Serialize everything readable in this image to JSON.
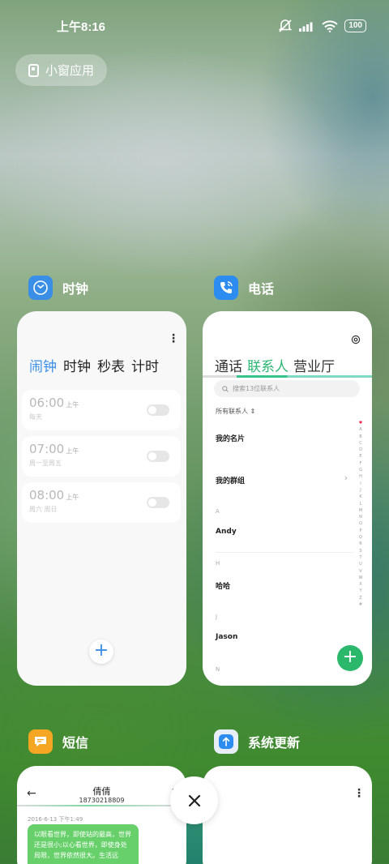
{
  "status_bar": {
    "time": "上午8:16",
    "battery": "100"
  },
  "small_window": {
    "label": "小窗应用"
  },
  "apps": {
    "clock": {
      "name": "时钟",
      "tabs": [
        "闹钟",
        "时钟",
        "秒表",
        "计时"
      ],
      "alarms": [
        {
          "time": "06:00",
          "ampm": "上午",
          "repeat": "每天"
        },
        {
          "time": "07:00",
          "ampm": "上午",
          "repeat": "周一至周五"
        },
        {
          "time": "08:00",
          "ampm": "上午",
          "repeat": "周六 周日"
        }
      ],
      "add": "+"
    },
    "phone": {
      "name": "电话",
      "tabs": [
        "通话",
        "联系人",
        "营业厅"
      ],
      "search_placeholder": "搜索13位联系人",
      "filter": "所有联系人",
      "my_card": "我的名片",
      "my_groups": "我的群组",
      "sections": [
        {
          "letter": "A",
          "name": "Andy"
        },
        {
          "letter": "H",
          "name": "哈哈"
        },
        {
          "letter": "J",
          "name": "Jason"
        },
        {
          "letter": "N",
          "name": ""
        }
      ],
      "alpha_index": [
        "A",
        "B",
        "C",
        "D",
        "E",
        "F",
        "G",
        "H",
        "I",
        "J",
        "K",
        "L",
        "M",
        "N",
        "O",
        "P",
        "Q",
        "R",
        "S",
        "T",
        "U",
        "V",
        "W",
        "X",
        "Y",
        "Z",
        "#"
      ],
      "add": "+"
    },
    "sms": {
      "name": "短信",
      "contact_name": "倩倩",
      "contact_number": "18730218809",
      "date": "2016-6-13 下午1:49",
      "message": "以眼看世界，即使站的最高，世界还是很小;以心看世界，即使身处局限，世界依然很大。生活远"
    },
    "update": {
      "name": "系统更新"
    }
  },
  "colors": {
    "clock_accent": "#3a8ee6",
    "phone_accent": "#2bb673",
    "sms_icon": "#f5a623",
    "phone_icon": "#2d8cf0",
    "update_icon": "#2d8cf0"
  }
}
